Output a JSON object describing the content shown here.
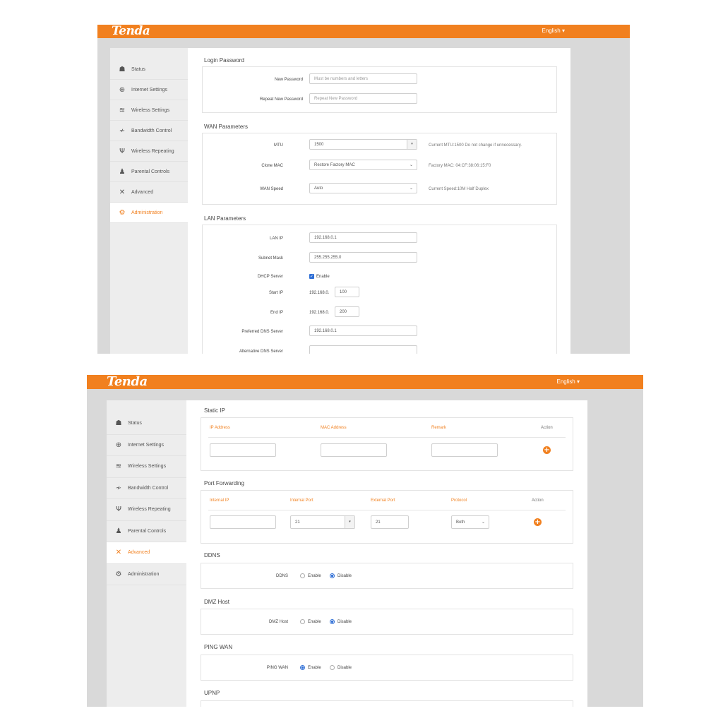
{
  "brand": "Tenda",
  "language": "English",
  "icons": {
    "status": "status-icon",
    "internet": "globe-icon",
    "wireless": "wifi-icon",
    "bandwidth": "bandwidth-icon",
    "repeating": "antenna-icon",
    "parental": "parental-icon",
    "advanced": "tools-icon",
    "administration": "gears-icon"
  },
  "colors": {
    "accent": "#f1801f",
    "radio": "#2f6fd6"
  },
  "sidebar": {
    "items": [
      {
        "label": "Status"
      },
      {
        "label": "Internet Settings"
      },
      {
        "label": "Wireless Settings"
      },
      {
        "label": "Bandwidth Control"
      },
      {
        "label": "Wireless Repeating"
      },
      {
        "label": "Parental Controls"
      },
      {
        "label": "Advanced"
      },
      {
        "label": "Administration"
      }
    ]
  },
  "screen1": {
    "active_item": "Administration",
    "login_password": {
      "title": "Login Password",
      "new_password_label": "New Password",
      "new_password_placeholder": "Must be numbers and letters",
      "repeat_password_label": "Repeat New Password",
      "repeat_password_placeholder": "Repeat New Password"
    },
    "wan": {
      "title": "WAN Parameters",
      "mtu_label": "MTU",
      "mtu_value": "1500",
      "mtu_note": "Current MTU:1500 Do not change if unnecessary.",
      "clone_mac_label": "Clone MAC",
      "clone_mac_value": "Restore Factory MAC",
      "clone_mac_note": "Factory MAC: 04:CF:38:06:15:F0",
      "wan_speed_label": "WAN Speed",
      "wan_speed_value": "Auto",
      "wan_speed_note": "Current Speed:10M Half Duplex"
    },
    "lan": {
      "title": "LAN Parameters",
      "lan_ip_label": "LAN IP",
      "lan_ip_value": "192.168.0.1",
      "subnet_label": "Subnet Mask",
      "subnet_value": "255.255.255.0",
      "dhcp_label": "DHCP Server",
      "dhcp_enable": "Enable",
      "start_ip_label": "Start IP",
      "start_ip_prefix": "192.168.0.",
      "start_ip_value": "100",
      "end_ip_label": "End IP",
      "end_ip_prefix": "192.168.0.",
      "end_ip_value": "200",
      "pref_dns_label": "Preferred DNS Server",
      "pref_dns_value": "192.168.0.1",
      "alt_dns_label": "Alternative DNS Server",
      "alt_dns_value": ""
    }
  },
  "screen2": {
    "active_item": "Advanced",
    "static_ip": {
      "title": "Static IP",
      "headers": [
        "IP Address",
        "MAC Address",
        "Remark",
        "Action"
      ]
    },
    "port_forwarding": {
      "title": "Port Forwarding",
      "headers": [
        "Internal IP",
        "Internal Port",
        "External Port",
        "Protocol",
        "Action"
      ],
      "internal_port": "21",
      "external_port": "21",
      "protocol": "Both"
    },
    "ddns": {
      "title": "DDNS",
      "label": "DDNS",
      "enable": "Enable",
      "disable": "Disable",
      "selected": "Disable"
    },
    "dmz": {
      "title": "DMZ Host",
      "label": "DMZ Host",
      "enable": "Enable",
      "disable": "Disable",
      "selected": "Disable"
    },
    "ping_wan": {
      "title": "PING WAN",
      "label": "PING WAN",
      "enable": "Enable",
      "disable": "Disable",
      "selected": "Enable"
    },
    "upnp": {
      "title": "UPNP"
    }
  }
}
